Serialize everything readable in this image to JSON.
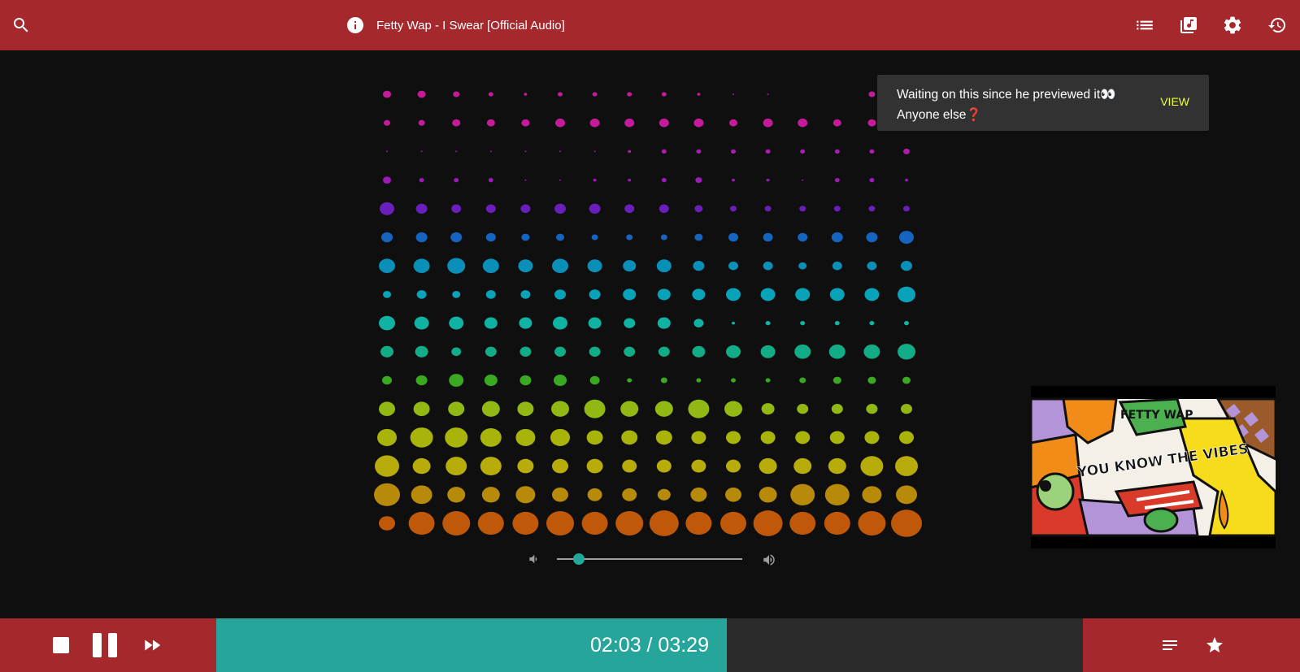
{
  "header": {
    "title": "Fetty Wap - I Swear [Official Audio]",
    "icons": [
      "search-icon",
      "info-icon",
      "queue-list-icon",
      "library-music-icon",
      "settings-gear-icon",
      "history-icon"
    ]
  },
  "toast": {
    "message_line1": "Waiting on this since he previewed it👀",
    "message_line2": "Anyone else❓",
    "action_label": "VIEW"
  },
  "player": {
    "time_display": "02:03 / 03:29",
    "progress_fraction": 0.589,
    "volume_fraction": 0.12,
    "icons": [
      "stop-icon",
      "pause-icon",
      "fast-forward-icon",
      "lyrics-lines-icon",
      "star-icon"
    ]
  },
  "thumbnail": {
    "brand_text": "FETTY WAP",
    "caption_text": "YOU KNOW THE VIBES"
  },
  "colors": {
    "bar_red": "#a5282d",
    "accent_teal": "#26a69a",
    "toast_bg": "#323232",
    "toast_action": "#eeff41",
    "background": "#0f0f0f"
  }
}
